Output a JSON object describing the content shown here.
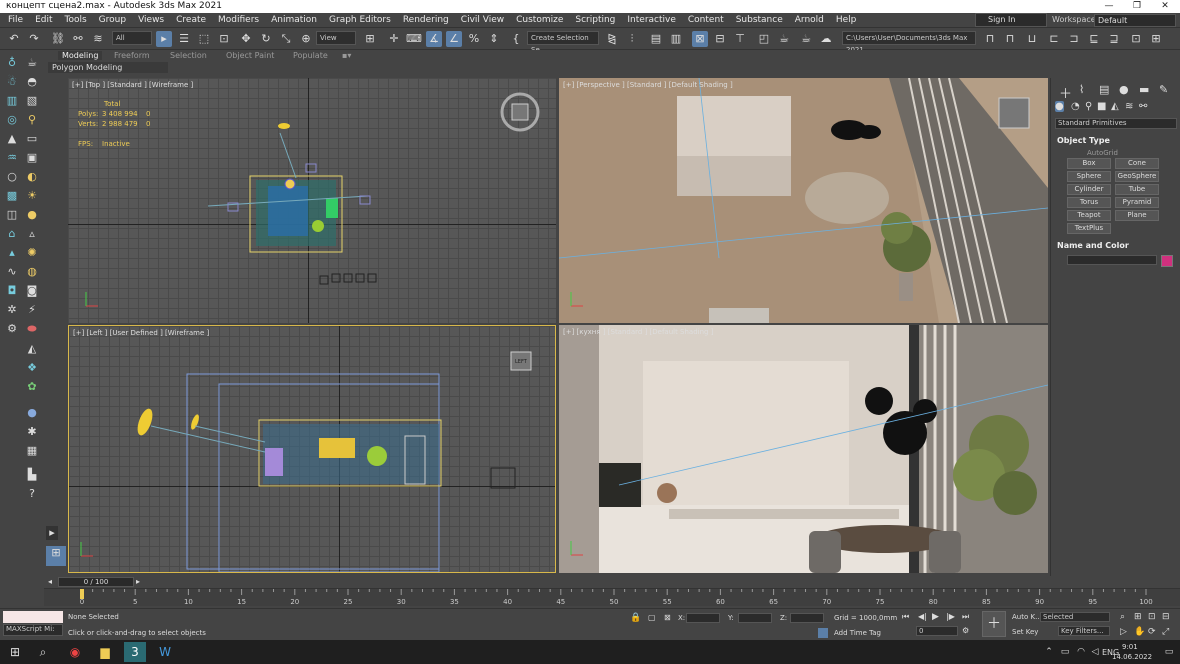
{
  "window": {
    "title": "концепт сцена2.max - Autodesk 3ds Max 2021"
  },
  "menu": [
    "File",
    "Edit",
    "Tools",
    "Group",
    "Views",
    "Create",
    "Modifiers",
    "Animation",
    "Graph Editors",
    "Rendering",
    "Civil View",
    "Customize",
    "Scripting",
    "Interactive",
    "Content",
    "Substance",
    "Arnold",
    "Help"
  ],
  "account": {
    "sign_in": "Sign In",
    "workspaces_label": "Workspaces:",
    "workspace_value": "Default"
  },
  "toolbar": {
    "filter": "All",
    "ref_coord": "View",
    "selection_set": "Create Selection Se",
    "path": "C:\\Users\\User\\Documents\\3ds Max 2021"
  },
  "ribbon": {
    "tabs": [
      "Modeling",
      "Freeform",
      "Selection",
      "Object Paint",
      "Populate"
    ],
    "panel": "Polygon Modeling"
  },
  "viewports": {
    "top": {
      "label": "[+] [Top ] [Standard ] [Wireframe ]",
      "stats_header": "Total",
      "polys_label": "Polys:",
      "polys": "3 408 994",
      "polys_sel": "0",
      "verts_label": "Verts:",
      "verts": "2 988 479",
      "verts_sel": "0",
      "fps_label": "FPS:",
      "fps": "Inactive"
    },
    "persp": {
      "label": "[+] [Perspective ] [Standard ] [Default Shading ]"
    },
    "left": {
      "label": "[+] [Left ] [User Defined ] [Wireframe ]",
      "cube_label": "LEFT"
    },
    "camera": {
      "label": "[+] [кухня ] [Standard ] [Default Shading ]"
    }
  },
  "cmdpanel": {
    "dropdown": "Standard Primitives",
    "object_type": "Object Type",
    "autogrid": "AutoGrid",
    "buttons": [
      "Box",
      "Cone",
      "Sphere",
      "GeoSphere",
      "Cylinder",
      "Tube",
      "Torus",
      "Pyramid",
      "Teapot",
      "Plane",
      "TextPlus"
    ],
    "name_color": "Name and Color",
    "color_swatch": "#d0307e"
  },
  "timeline": {
    "frame": "0 / 100",
    "ticks": [
      "0",
      "5",
      "10",
      "15",
      "20",
      "25",
      "30",
      "35",
      "40",
      "45",
      "50",
      "55",
      "60",
      "65",
      "70",
      "75",
      "80",
      "85",
      "90",
      "95",
      "100"
    ]
  },
  "status": {
    "maxscript": "MAXScript Mi:",
    "selection": "None Selected",
    "prompt": "Click or click-and-drag to select objects",
    "x_label": "X:",
    "y_label": "Y:",
    "z_label": "Z:",
    "grid": "Grid = 1000,0mm",
    "add_time_tag": "Add Time Tag",
    "auto_key": "Auto K...",
    "selected": "Selected",
    "set_key": "Set Key",
    "key_filters": "Key Filters...",
    "frame_value": "0"
  },
  "taskbar": {
    "lang": "ENG",
    "time": "9:01",
    "date": "14.06.2022"
  }
}
